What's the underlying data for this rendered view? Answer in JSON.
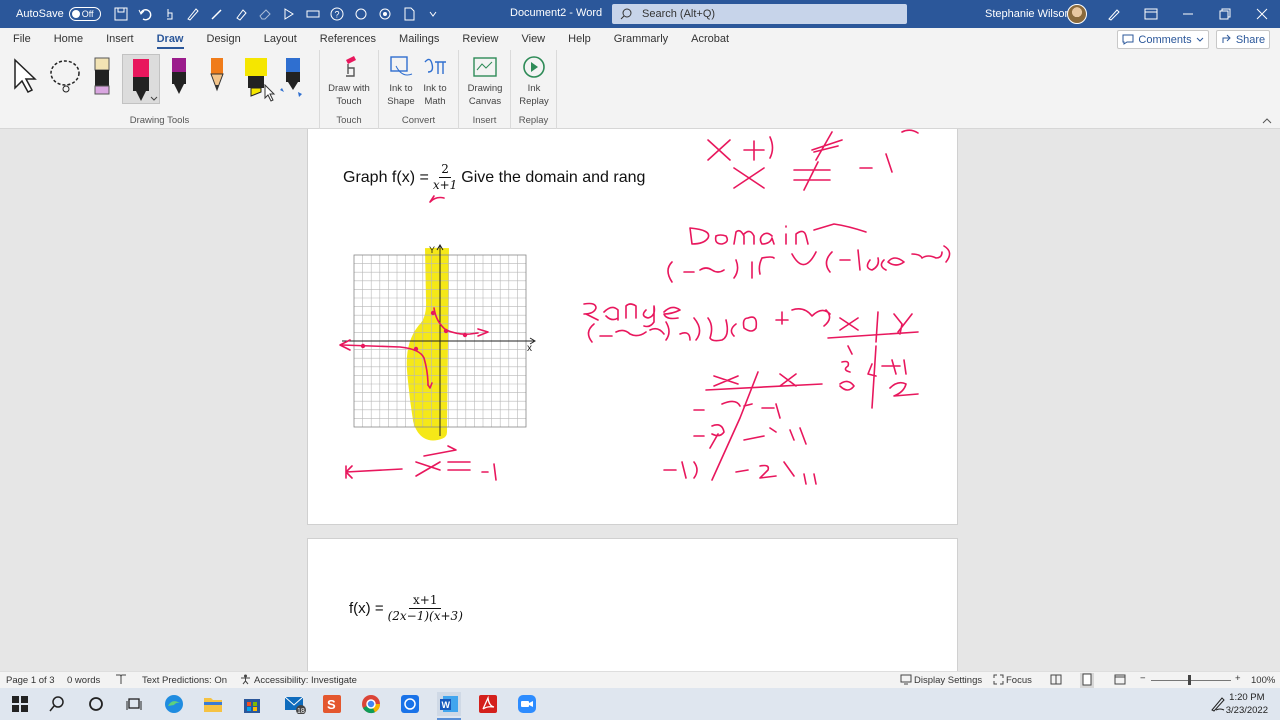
{
  "titlebar": {
    "autosave_label": "AutoSave",
    "autosave_state": "Off",
    "document_title": "Document2 - Word",
    "search_placeholder": "Search (Alt+Q)",
    "user_name": "Stephanie Wilson"
  },
  "tabs": [
    "File",
    "Home",
    "Insert",
    "Draw",
    "Design",
    "Layout",
    "References",
    "Mailings",
    "Review",
    "View",
    "Help",
    "Grammarly",
    "Acrobat"
  ],
  "active_tab": "Draw",
  "comments_label": "Comments",
  "share_label": "Share",
  "ribbon": {
    "groups": {
      "drawing_tools": "Drawing Tools",
      "touch": "Touch",
      "convert": "Convert",
      "insert": "Insert",
      "replay": "Replay"
    },
    "buttons": {
      "draw_with_touch_1": "Draw with",
      "draw_with_touch_2": "Touch",
      "ink_to_shape_1": "Ink to",
      "ink_to_shape_2": "Shape",
      "ink_to_math_1": "Ink to",
      "ink_to_math_2": "Math",
      "drawing_canvas_1": "Drawing",
      "drawing_canvas_2": "Canvas",
      "ink_replay_1": "Ink",
      "ink_replay_2": "Replay"
    },
    "pen_colors": [
      "#222222",
      "#e8175d",
      "#9b1c8c",
      "#f07c1a",
      "#f5e600",
      "#2f6fd0"
    ]
  },
  "document": {
    "q1_prefix": "Graph f(x) =",
    "q1_num": "2",
    "q1_den": "x+1",
    "q1_suffix": "Give the domain and rang",
    "graph_axis_x": "x",
    "graph_axis_y": "Y",
    "q2_prefix": "f(x) =",
    "q2_num": "x+1",
    "q2_den": "(2x−1)(x+3)"
  },
  "status": {
    "page": "Page 1 of 3",
    "words": "0 words",
    "text_predictions": "Text Predictions: On",
    "accessibility": "Accessibility: Investigate",
    "display_settings": "Display Settings",
    "focus": "Focus",
    "zoom": "100%"
  },
  "taskbar": {
    "mail_badge": "18",
    "time": "1:20 PM",
    "date": "3/23/2022"
  },
  "colors": {
    "word_blue": "#2b579a",
    "ink_red": "#e8175d",
    "highlighter": "#f5e600"
  }
}
